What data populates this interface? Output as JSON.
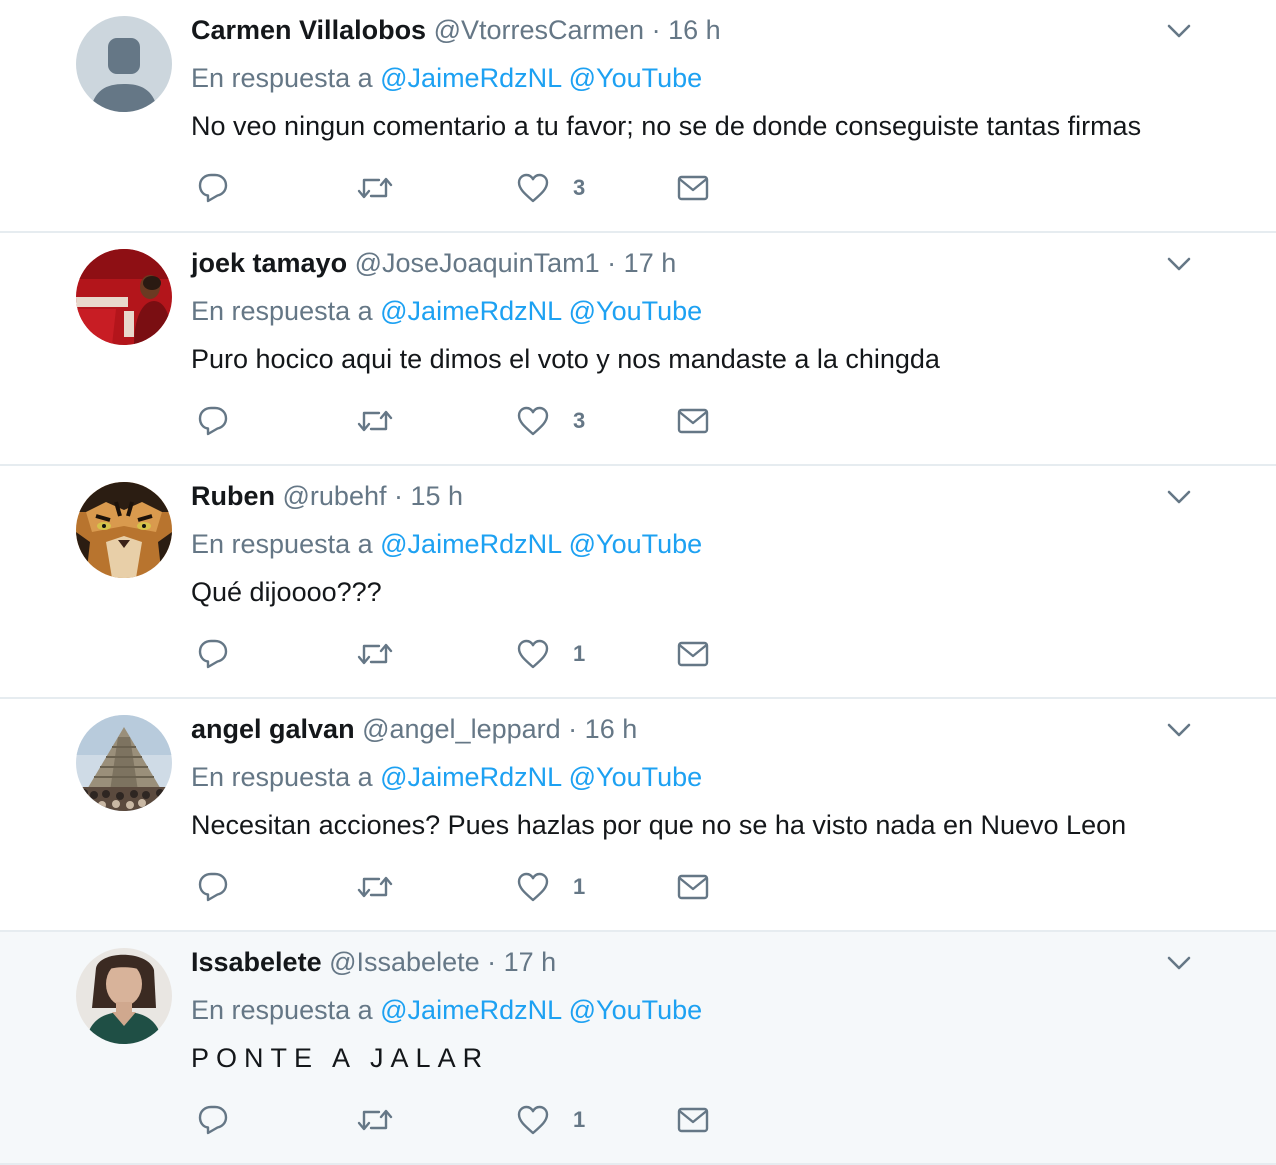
{
  "colors": {
    "accent": "#1da1f2",
    "muted": "#657786",
    "text": "#14171a",
    "divider": "#e6ecf0"
  },
  "reply_prefix": "En respuesta a",
  "tweets": [
    {
      "name": "Carmen Villalobos",
      "handle": "@VtorresCarmen",
      "separator": "·",
      "time": "16 h",
      "mentions": [
        "@JaimeRdzNL",
        "@YouTube"
      ],
      "text": "No veo ningun comentario a tu favor; no se de donde conseguiste tantas firmas",
      "likes": "3",
      "avatar_icon": "default-avatar-icon"
    },
    {
      "name": "joek tamayo",
      "handle": "@JoseJoaquinTam1",
      "separator": "·",
      "time": "17 h",
      "mentions": [
        "@JaimeRdzNL",
        "@YouTube"
      ],
      "text": "Puro hocico aqui te dimos el voto y nos mandaste a la chingda",
      "likes": "3",
      "avatar_icon": "photo-avatar"
    },
    {
      "name": "Ruben",
      "handle": "@rubehf",
      "separator": "·",
      "time": "15 h",
      "mentions": [
        "@JaimeRdzNL",
        "@YouTube"
      ],
      "text": "Qué dijoooo???",
      "likes": "1",
      "avatar_icon": "tiger-avatar"
    },
    {
      "name": "angel galvan",
      "handle": "@angel_leppard",
      "separator": "·",
      "time": "16 h",
      "mentions": [
        "@JaimeRdzNL",
        "@YouTube"
      ],
      "text": "Necesitan acciones? Pues hazlas por que no se ha visto nada en Nuevo Leon",
      "likes": "1",
      "avatar_icon": "pyramid-avatar"
    },
    {
      "name": "Issabelete",
      "handle": "@Issabelete",
      "separator": "·",
      "time": "17 h",
      "mentions": [
        "@JaimeRdzNL",
        "@YouTube"
      ],
      "text": "PONTE A JALAR",
      "likes": "1",
      "avatar_icon": "portrait-avatar"
    }
  ]
}
